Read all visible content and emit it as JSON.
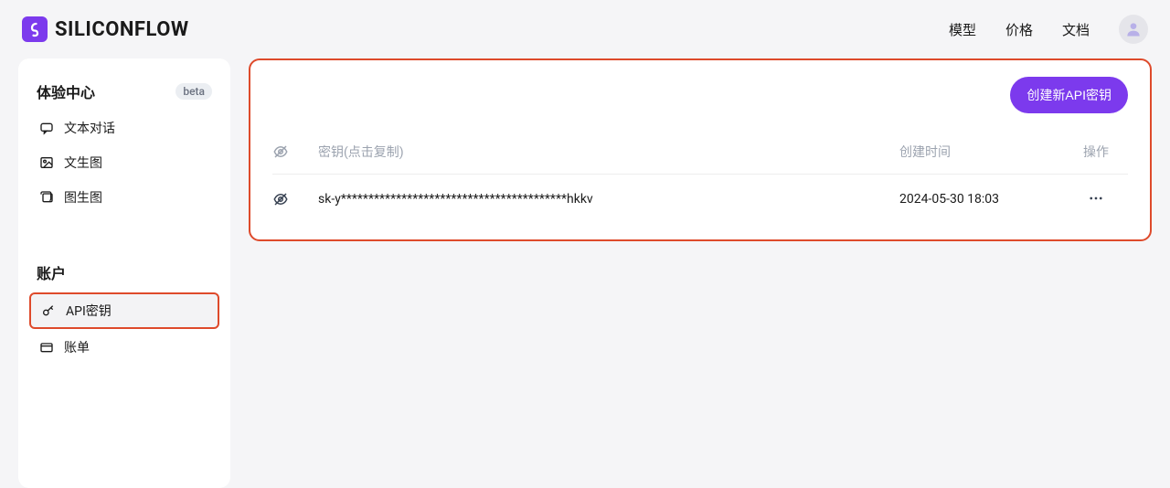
{
  "header": {
    "brand": "SILICONFLOW",
    "nav": {
      "models": "模型",
      "pricing": "价格",
      "docs": "文档"
    }
  },
  "sidebar": {
    "section_experience": {
      "title": "体验中心",
      "badge": "beta",
      "items": {
        "text_chat": "文本对话",
        "text_to_image": "文生图",
        "image_to_image": "图生图"
      }
    },
    "section_account": {
      "title": "账户",
      "items": {
        "api_keys": "API密钥",
        "billing": "账单"
      }
    }
  },
  "main": {
    "create_button": "创建新API密钥",
    "table": {
      "headers": {
        "key": "密钥(点击复制)",
        "created_at": "创建时间",
        "actions": "操作"
      },
      "rows": [
        {
          "masked_key": "sk-y*****************************************hkkv",
          "created_at": "2024-05-30 18:03"
        }
      ]
    }
  }
}
